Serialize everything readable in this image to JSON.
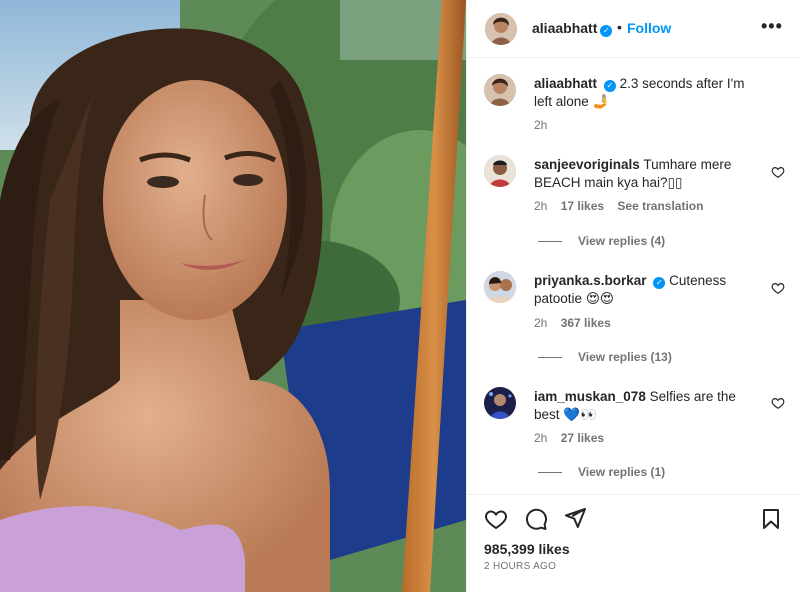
{
  "post": {
    "username": "aliaabhatt",
    "follow_label": "Follow",
    "dot": "•",
    "more_label": "•••",
    "verified_mark": "✓"
  },
  "caption": {
    "username": "aliaabhatt",
    "text": "2.3 seconds after I'm left alone",
    "emoji": "🤳",
    "time": "2h"
  },
  "comments": [
    {
      "username": "sanjeevoriginals",
      "text": "Tumhare mere BEACH main kya hai?",
      "text_suffix": "▯▯",
      "verified": false,
      "time": "2h",
      "likes": "17 likes",
      "extra": "See translation",
      "replies": "View replies (4)"
    },
    {
      "username": "priyanka.s.borkar",
      "text": "Cuteness patootie",
      "text_suffix": "😍😍",
      "verified": true,
      "time": "2h",
      "likes": "367 likes",
      "extra": "",
      "replies": "View replies (13)"
    },
    {
      "username": "iam_muskan_078",
      "text": "Selfies are the best",
      "text_suffix": "💙👀",
      "verified": false,
      "time": "2h",
      "likes": "27 likes",
      "extra": "",
      "replies": "View replies (1)"
    }
  ],
  "footer": {
    "likes": "985,399 likes",
    "time_ago": "2 HOURS AGO"
  },
  "icons": {
    "like": "heart-icon",
    "comment": "comment-icon",
    "share": "share-icon",
    "save": "bookmark-icon",
    "more": "more-horizontal-icon",
    "verified": "verified-badge-icon"
  },
  "colors": {
    "accent": "#0095f6",
    "text": "#262626",
    "muted": "#737373",
    "divider": "#efefef"
  }
}
